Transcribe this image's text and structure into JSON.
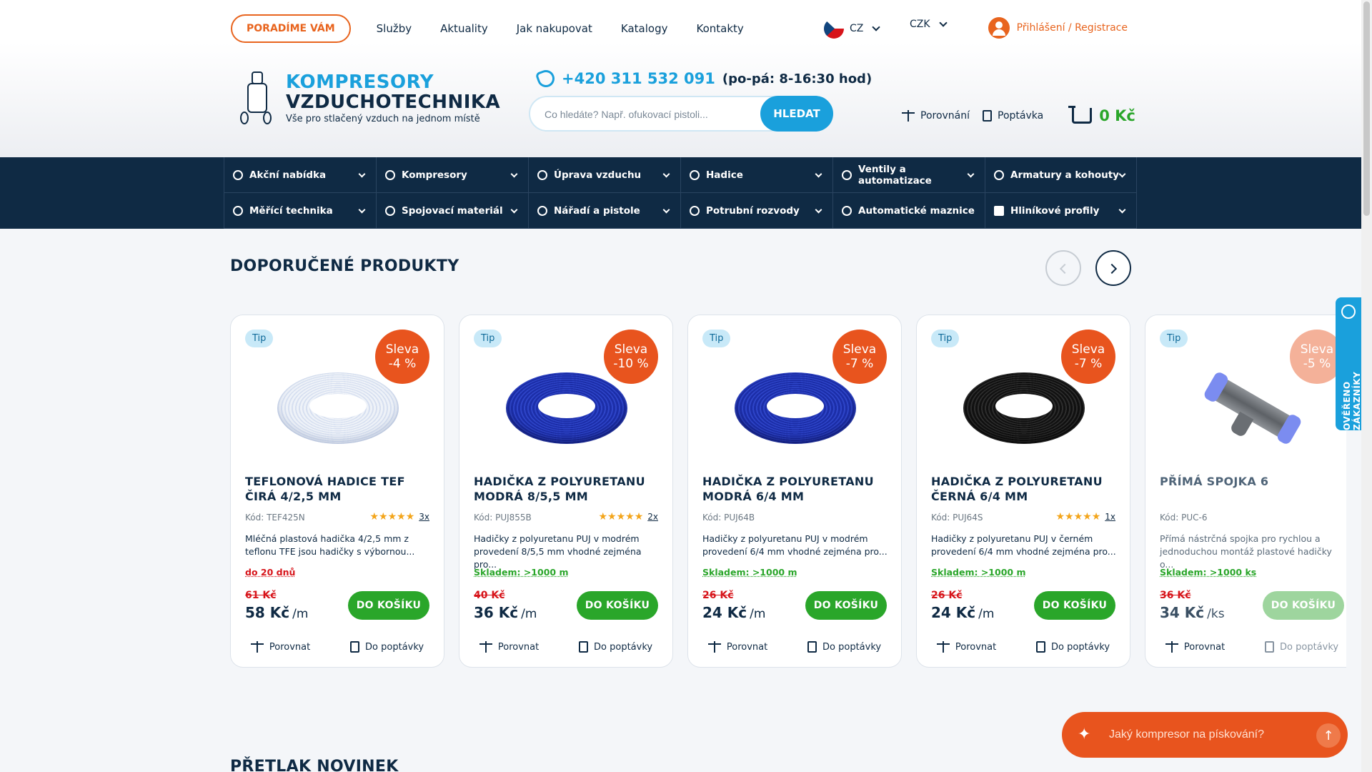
{
  "header": {
    "advise_label": "PORADÍME VÁM",
    "nav": [
      "Služby",
      "Aktuality",
      "Jak nakupovat",
      "Katalogy",
      "Kontakty"
    ],
    "language": "CZ",
    "currency": "CZK",
    "login_label": "Přihlášení / Registrace",
    "logo_line1": "KOMPRESORY",
    "logo_line2": "VZDUCHOTECHNIKA",
    "logo_tagline": "Vše pro stlačený vzduch na jednom místě",
    "phone": "+420 311 532 091",
    "phone_hours": "(po-pá: 8-16:30 hod)",
    "search_placeholder": "Co hledáte? Např. ofukovací pistoli...",
    "search_button": "HLEDAT",
    "compare_label": "Porovnání",
    "inquiry_label": "Poptávka",
    "cart_total": "0 Kč"
  },
  "categories": [
    "Akční nabídka",
    "Kompresory",
    "Úprava vzduchu",
    "Hadice",
    "Ventily a automatizace",
    "Armatury a kohouty",
    "Měřící technika",
    "Spojovací materiál",
    "Nářadí a pistole",
    "Potrubní rozvody",
    "Automatické maznice",
    "Hliníkové profily"
  ],
  "recommended": {
    "title": "DOPORUČENÉ PRODUKTY",
    "products": [
      {
        "tip": "Tip",
        "sale_word": "Sleva",
        "sale_pct": "-4 %",
        "name": "TEFLONOVÁ HADICE TEF ČIRÁ 4/2,5 MM",
        "code": "Kód: TEF425N",
        "stars": "★★★★★",
        "reviews": "3x",
        "desc": "Mléčná plastová hadička 4/2,5 mm z teflonu TFE jsou hadičky s výbornou...",
        "stock": "do 20 dnů",
        "old_price": "61 Kč",
        "price": "58 Kč",
        "unit": "/m",
        "buy": "DO KOŠÍKU",
        "compare": "Porovnat",
        "inquiry": "Do poptávky",
        "color": "white"
      },
      {
        "tip": "Tip",
        "sale_word": "Sleva",
        "sale_pct": "-10 %",
        "name": "HADIČKA Z POLYURETANU MODRÁ 8/5,5 MM",
        "code": "Kód: PUJ855B",
        "stars": "★★★★★",
        "reviews": "2x",
        "desc": "Hadičky z polyuretanu PUJ v modrém provedení 8/5,5 mm vhodné zejména pro...",
        "stock": "Skladem: >1000 m",
        "old_price": "40 Kč",
        "price": "36 Kč",
        "unit": "/m",
        "buy": "DO KOŠÍKU",
        "compare": "Porovnat",
        "inquiry": "Do poptávky",
        "color": "blue"
      },
      {
        "tip": "Tip",
        "sale_word": "Sleva",
        "sale_pct": "-7 %",
        "name": "HADIČKA Z POLYURETANU MODRÁ 6/4 MM",
        "code": "Kód: PUJ64B",
        "stars": "",
        "reviews": "",
        "desc": "Hadičky z polyuretanu PUJ v modrém provedení 6/4 mm vhodné zejména pro...",
        "stock": "Skladem: >1000 m",
        "old_price": "26 Kč",
        "price": "24 Kč",
        "unit": "/m",
        "buy": "DO KOŠÍKU",
        "compare": "Porovnat",
        "inquiry": "Do poptávky",
        "color": "blue"
      },
      {
        "tip": "Tip",
        "sale_word": "Sleva",
        "sale_pct": "-7 %",
        "name": "HADIČKA Z POLYURETANU ČERNÁ 6/4 MM",
        "code": "Kód: PUJ64S",
        "stars": "★★★★★",
        "reviews": "1x",
        "desc": "Hadičky z polyuretanu PUJ v černém provedení 6/4 mm vhodné zejména pro...",
        "stock": "Skladem: >1000 m",
        "old_price": "26 Kč",
        "price": "24 Kč",
        "unit": "/m",
        "buy": "DO KOŠÍKU",
        "compare": "Porovnat",
        "inquiry": "Do poptávky",
        "color": "black"
      },
      {
        "tip": "Tip",
        "sale_word": "Sleva",
        "sale_pct": "-5 %",
        "name": "PŘÍMÁ SPOJKA 6",
        "code": "Kód: PUC-6",
        "stars": "",
        "reviews": "",
        "desc": "Přímá nástrčná spojka pro rychlou a jednoduchou montáž plastové hadičky o...",
        "stock": "Skladem: >1000 ks",
        "old_price": "36 Kč",
        "price": "34 Kč",
        "unit": "/ks",
        "buy": "DO KOŠÍKU",
        "compare": "Porovnat",
        "inquiry": "Do poptávky",
        "color": "fitting"
      }
    ]
  },
  "verified_label": "OVĚŘENO ZÁKAZNÍKY",
  "chat_placeholder": "Jaký kompresor na pískování?",
  "next_section_title": "PŘETLAK NOVINEK"
}
